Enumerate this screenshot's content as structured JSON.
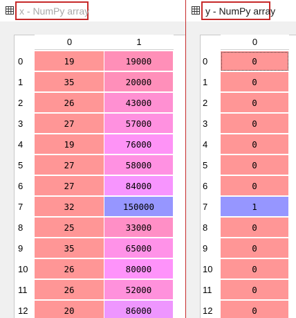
{
  "windows": [
    {
      "id": "win-x",
      "title": "x - NumPy array",
      "title_icon": "table-grid-icon",
      "columns": [
        "0",
        "1"
      ],
      "rows": [
        "0",
        "1",
        "2",
        "3",
        "4",
        "5",
        "6",
        "7",
        "8",
        "9",
        "10",
        "11",
        "12"
      ],
      "cells": [
        [
          "19",
          "19000"
        ],
        [
          "35",
          "20000"
        ],
        [
          "26",
          "43000"
        ],
        [
          "27",
          "57000"
        ],
        [
          "19",
          "76000"
        ],
        [
          "27",
          "58000"
        ],
        [
          "27",
          "84000"
        ],
        [
          "32",
          "150000"
        ],
        [
          "25",
          "33000"
        ],
        [
          "35",
          "65000"
        ],
        [
          "26",
          "80000"
        ],
        [
          "26",
          "52000"
        ],
        [
          "20",
          "86000"
        ]
      ],
      "cell_colors": [
        [
          "#ff9696",
          "#ff8fb8"
        ],
        [
          "#ff9696",
          "#ff8fba"
        ],
        [
          "#ff9696",
          "#ff90d2"
        ],
        [
          "#ff9696",
          "#ff91e0"
        ],
        [
          "#ff9696",
          "#fe93f6"
        ],
        [
          "#ff9696",
          "#ff91e2"
        ],
        [
          "#ff9696",
          "#f795fe"
        ],
        [
          "#ff9696",
          "#9696ff"
        ],
        [
          "#ff9696",
          "#ff8fc6"
        ],
        [
          "#ff9696",
          "#ff92e8"
        ],
        [
          "#ff9696",
          "#fe93fa"
        ],
        [
          "#ff9696",
          "#ff91dc"
        ],
        [
          "#ff9696",
          "#ee96fe"
        ]
      ]
    },
    {
      "id": "win-y",
      "title": "y - NumPy array",
      "title_icon": "table-grid-icon",
      "columns": [
        "0"
      ],
      "rows": [
        "0",
        "1",
        "2",
        "3",
        "4",
        "5",
        "6",
        "7",
        "8",
        "9",
        "10",
        "11",
        "12"
      ],
      "cells": [
        [
          "0"
        ],
        [
          "0"
        ],
        [
          "0"
        ],
        [
          "0"
        ],
        [
          "0"
        ],
        [
          "0"
        ],
        [
          "0"
        ],
        [
          "1"
        ],
        [
          "0"
        ],
        [
          "0"
        ],
        [
          "0"
        ],
        [
          "0"
        ],
        [
          "0"
        ]
      ],
      "cell_colors": [
        [
          "#ff9696"
        ],
        [
          "#ff9696"
        ],
        [
          "#ff9696"
        ],
        [
          "#ff9696"
        ],
        [
          "#ff9696"
        ],
        [
          "#ff9696"
        ],
        [
          "#ff9696"
        ],
        [
          "#9696ff"
        ],
        [
          "#ff9696"
        ],
        [
          "#ff9696"
        ],
        [
          "#ff9696"
        ],
        [
          "#ff9696"
        ],
        [
          "#ff9696"
        ]
      ],
      "selected_cell": [
        0,
        0
      ]
    }
  ],
  "colors": {
    "highlight_border": "#c62828",
    "low_value": "#ff9696",
    "high_value": "#9696ff"
  }
}
